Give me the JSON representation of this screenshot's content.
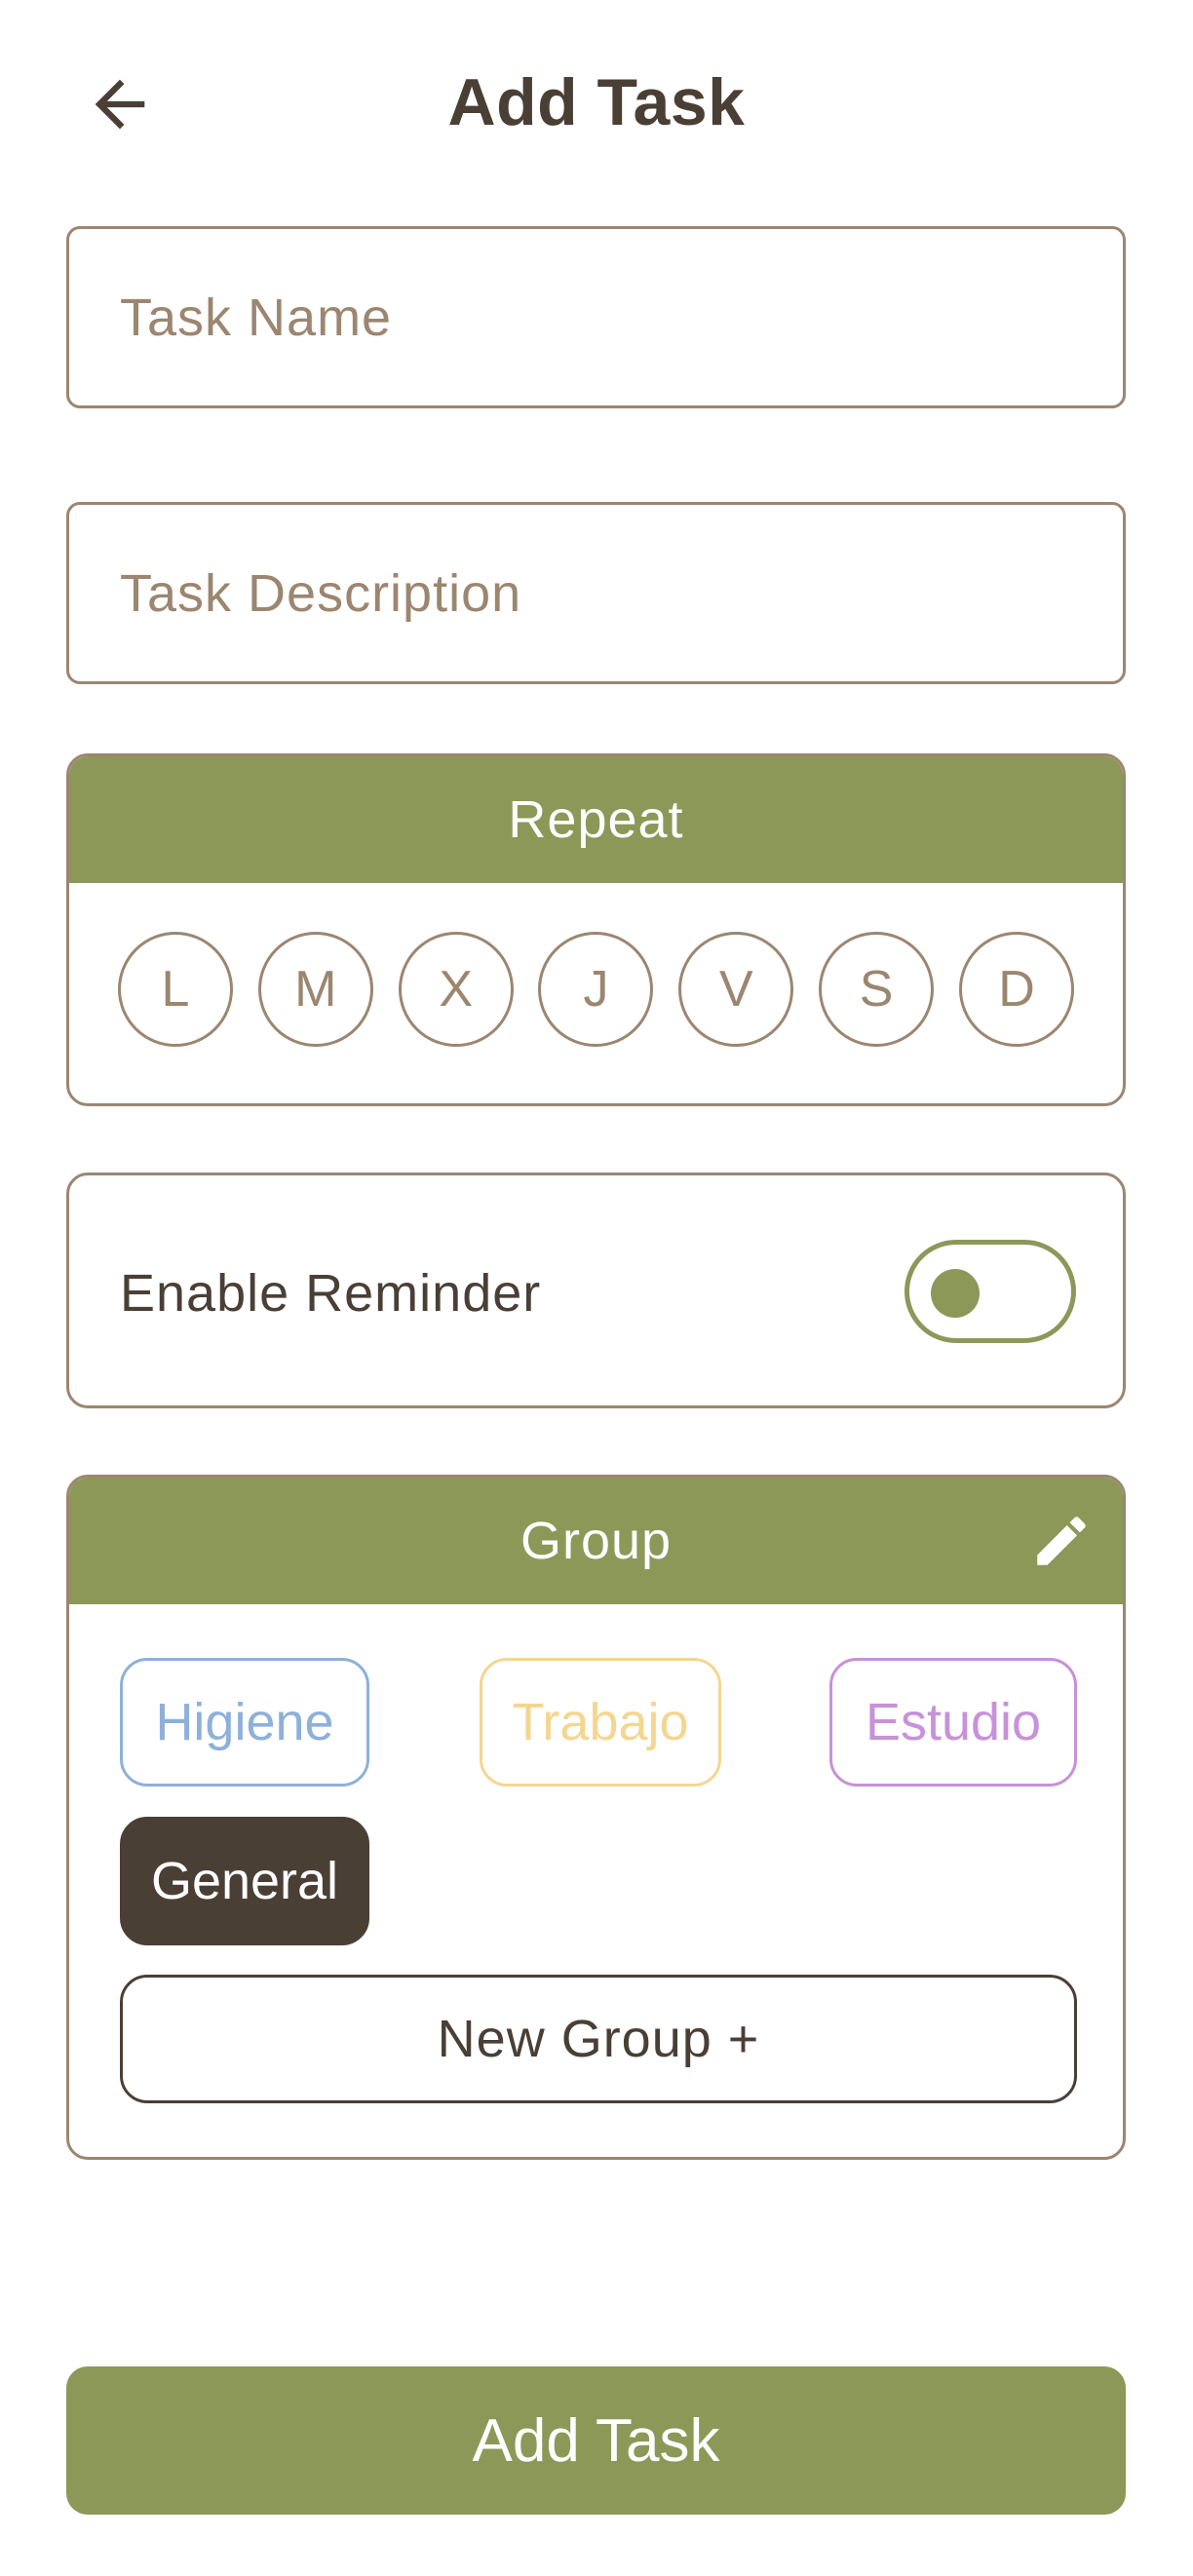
{
  "header": {
    "title": "Add Task",
    "back_icon": "arrow-left-icon"
  },
  "form": {
    "task_name": {
      "value": "",
      "placeholder": "Task Name"
    },
    "task_description": {
      "value": "",
      "placeholder": "Task Description"
    }
  },
  "repeat": {
    "title": "Repeat",
    "days": [
      "L",
      "M",
      "X",
      "J",
      "V",
      "S",
      "D"
    ]
  },
  "reminder": {
    "label": "Enable Reminder",
    "enabled": false
  },
  "group": {
    "title": "Group",
    "edit_icon": "pencil-icon",
    "chips": [
      {
        "label": "Higiene",
        "color": "#8eb0da",
        "selected": false
      },
      {
        "label": "Trabajo",
        "color": "#f5d690",
        "selected": false
      },
      {
        "label": "Estudio",
        "color": "#c891d9",
        "selected": false
      },
      {
        "label": "General",
        "color": "#4a3f35",
        "selected": true
      }
    ],
    "new_group_label": "New Group +"
  },
  "submit": {
    "label": "Add Task"
  },
  "colors": {
    "accent": "#8c9858",
    "border": "#9c8670",
    "text_dark": "#4a3f35"
  }
}
